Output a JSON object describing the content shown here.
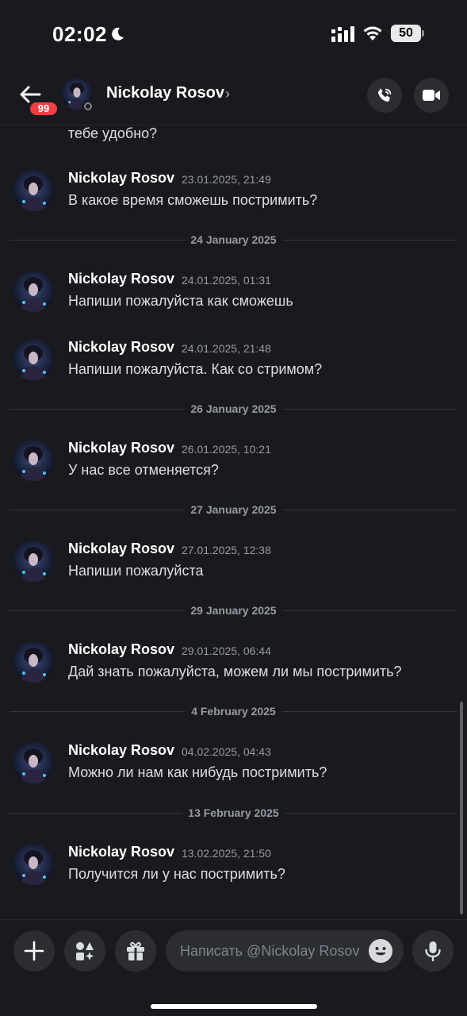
{
  "status_bar": {
    "time": "02:02",
    "battery": "50"
  },
  "header": {
    "unread_count": "99",
    "contact_name": "Nickolay Rosov",
    "chevron": "›"
  },
  "partial_message": "тебе удобно?",
  "messages": [
    {
      "author": "Nickolay Rosov",
      "timestamp": "23.01.2025, 21:49",
      "text": "В какое время сможешь постримить?"
    },
    {
      "author": "Nickolay Rosov",
      "timestamp": "24.01.2025, 01:31",
      "text": "Напиши пожалуйста как сможешь"
    },
    {
      "author": "Nickolay Rosov",
      "timestamp": "24.01.2025, 21:48",
      "text": "Напиши пожалуйста. Как со стримом?"
    },
    {
      "author": "Nickolay Rosov",
      "timestamp": "26.01.2025, 10:21",
      "text": "У нас все отменяется?"
    },
    {
      "author": "Nickolay Rosov",
      "timestamp": "27.01.2025, 12:38",
      "text": "Напиши пожалуйста"
    },
    {
      "author": "Nickolay Rosov",
      "timestamp": "29.01.2025, 06:44",
      "text": "Дай знать пожалуйста, можем ли мы постримить?"
    },
    {
      "author": "Nickolay Rosov",
      "timestamp": "04.02.2025, 04:43",
      "text": "Можно ли нам как нибудь постримить?"
    },
    {
      "author": "Nickolay Rosov",
      "timestamp": "13.02.2025, 21:50",
      "text": "Получится ли у нас постримить?"
    }
  ],
  "date_dividers": [
    "24 January 2025",
    "26 January 2025",
    "27 January 2025",
    "29 January 2025",
    "4 February 2025",
    "13 February 2025"
  ],
  "composer": {
    "placeholder": "Написать @Nickolay Rosov"
  },
  "icons": {
    "back": "arrow-left-icon",
    "call": "phone-icon",
    "video": "video-camera-icon",
    "plus": "plus-icon",
    "apps": "apps-icon",
    "gift": "gift-icon",
    "emoji": "emoji-icon",
    "mic": "microphone-icon",
    "moon": "moon-icon",
    "signal": "cellular-signal-icon",
    "wifi": "wifi-icon",
    "battery": "battery-icon"
  },
  "colors": {
    "background": "#1a1a1e",
    "badge": "#f23f43",
    "button": "#2b2d31",
    "muted": "#949ba4"
  }
}
